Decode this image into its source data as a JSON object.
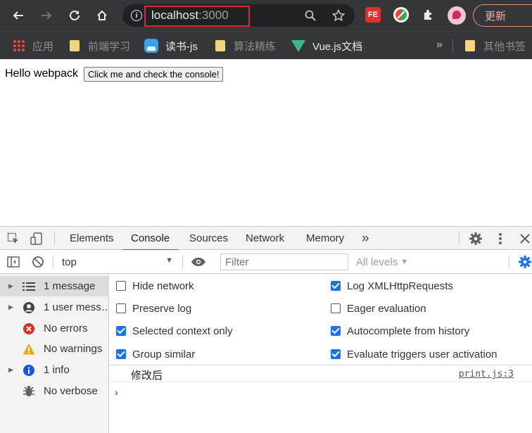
{
  "browser": {
    "url_host": "localhost",
    "url_port": ":3000",
    "update_label": "更新"
  },
  "bookmarks": [
    {
      "label": "应用"
    },
    {
      "label": "前端学习"
    },
    {
      "label": "读书-js"
    },
    {
      "label": "算法精练"
    },
    {
      "label": "Vue.js文档"
    },
    {
      "label": "其他书签"
    }
  ],
  "extensions": {
    "fe_label": "FE"
  },
  "page": {
    "hello_text": "Hello webpack",
    "button_label": "Click me and check the console!"
  },
  "devtools": {
    "tabs": [
      {
        "label": "Elements"
      },
      {
        "label": "Console"
      },
      {
        "label": "Sources"
      },
      {
        "label": "Network"
      },
      {
        "label": "Memory"
      }
    ],
    "more_tabs_label": "»",
    "context": "top",
    "filter_placeholder": "Filter",
    "levels_label": "All levels",
    "sidebar": [
      {
        "label": "1 message",
        "icon": "list-icon"
      },
      {
        "label": "1 user mess…",
        "icon": "user-icon"
      },
      {
        "label": "No errors",
        "icon": "error-icon"
      },
      {
        "label": "No warnings",
        "icon": "warning-icon"
      },
      {
        "label": "1 info",
        "icon": "info-icon"
      },
      {
        "label": "No verbose",
        "icon": "bug-icon"
      }
    ],
    "settings": {
      "hide_network": {
        "label": "Hide network",
        "checked": false
      },
      "preserve_log": {
        "label": "Preserve log",
        "checked": false
      },
      "selected_context_only": {
        "label": "Selected context only",
        "checked": true
      },
      "group_similar": {
        "label": "Group similar",
        "checked": true
      },
      "log_xhr": {
        "label": "Log XMLHttpRequests",
        "checked": true
      },
      "eager_evaluation": {
        "label": "Eager evaluation",
        "checked": false
      },
      "autocomplete_history": {
        "label": "Autocomplete from history",
        "checked": true
      },
      "evaluate_triggers": {
        "label": "Evaluate triggers user activation",
        "checked": true
      }
    },
    "log": {
      "text": "修改后",
      "source": "print.js:3"
    },
    "prompt": "›"
  },
  "colors": {
    "accent": "#1a73e8",
    "highlight_box": "#e0262e",
    "chrome_bg": "#35363a"
  }
}
